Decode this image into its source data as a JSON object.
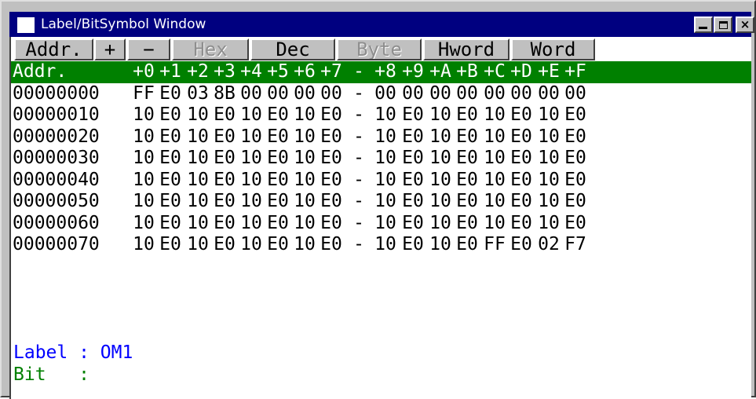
{
  "window": {
    "title": "Label/BitSymbol Window",
    "controls": {
      "minimize": "_",
      "maximize": "□",
      "close": "×"
    }
  },
  "toolbar": {
    "buttons": [
      {
        "label": "Addr.",
        "enabled": true
      },
      {
        "label": "+",
        "enabled": true
      },
      {
        "label": "−",
        "enabled": true
      },
      {
        "label": "Hex",
        "enabled": false
      },
      {
        "label": "Dec",
        "enabled": true
      },
      {
        "label": "Byte",
        "enabled": false
      },
      {
        "label": "Hword",
        "enabled": true
      },
      {
        "label": "Word",
        "enabled": true
      }
    ]
  },
  "dump": {
    "header": {
      "addr": "Addr.",
      "columns": [
        "+0",
        "+1",
        "+2",
        "+3",
        "+4",
        "+5",
        "+6",
        "+7",
        "-",
        "+8",
        "+9",
        "+A",
        "+B",
        "+C",
        "+D",
        "+E",
        "+F"
      ]
    },
    "rows": [
      {
        "addr": "00000000",
        "values": [
          "FF",
          "E0",
          "03",
          "8B",
          "00",
          "00",
          "00",
          "00",
          "-",
          "00",
          "00",
          "00",
          "00",
          "00",
          "00",
          "00",
          "00"
        ]
      },
      {
        "addr": "00000010",
        "values": [
          "10",
          "E0",
          "10",
          "E0",
          "10",
          "E0",
          "10",
          "E0",
          "-",
          "10",
          "E0",
          "10",
          "E0",
          "10",
          "E0",
          "10",
          "E0"
        ]
      },
      {
        "addr": "00000020",
        "values": [
          "10",
          "E0",
          "10",
          "E0",
          "10",
          "E0",
          "10",
          "E0",
          "-",
          "10",
          "E0",
          "10",
          "E0",
          "10",
          "E0",
          "10",
          "E0"
        ]
      },
      {
        "addr": "00000030",
        "values": [
          "10",
          "E0",
          "10",
          "E0",
          "10",
          "E0",
          "10",
          "E0",
          "-",
          "10",
          "E0",
          "10",
          "E0",
          "10",
          "E0",
          "10",
          "E0"
        ]
      },
      {
        "addr": "00000040",
        "values": [
          "10",
          "E0",
          "10",
          "E0",
          "10",
          "E0",
          "10",
          "E0",
          "-",
          "10",
          "E0",
          "10",
          "E0",
          "10",
          "E0",
          "10",
          "E0"
        ]
      },
      {
        "addr": "00000050",
        "values": [
          "10",
          "E0",
          "10",
          "E0",
          "10",
          "E0",
          "10",
          "E0",
          "-",
          "10",
          "E0",
          "10",
          "E0",
          "10",
          "E0",
          "10",
          "E0"
        ]
      },
      {
        "addr": "00000060",
        "values": [
          "10",
          "E0",
          "10",
          "E0",
          "10",
          "E0",
          "10",
          "E0",
          "-",
          "10",
          "E0",
          "10",
          "E0",
          "10",
          "E0",
          "10",
          "E0"
        ]
      },
      {
        "addr": "00000070",
        "values": [
          "10",
          "E0",
          "10",
          "E0",
          "10",
          "E0",
          "10",
          "E0",
          "-",
          "10",
          "E0",
          "10",
          "E0",
          "FF",
          "E0",
          "02",
          "F7"
        ]
      }
    ]
  },
  "info": {
    "label_line": "Label : OM1",
    "bit_line": "Bit   :"
  },
  "colors": {
    "title_bar": "#000080",
    "header_bg": "#008000",
    "label_text": "#0000ff",
    "bit_text": "#008000"
  }
}
